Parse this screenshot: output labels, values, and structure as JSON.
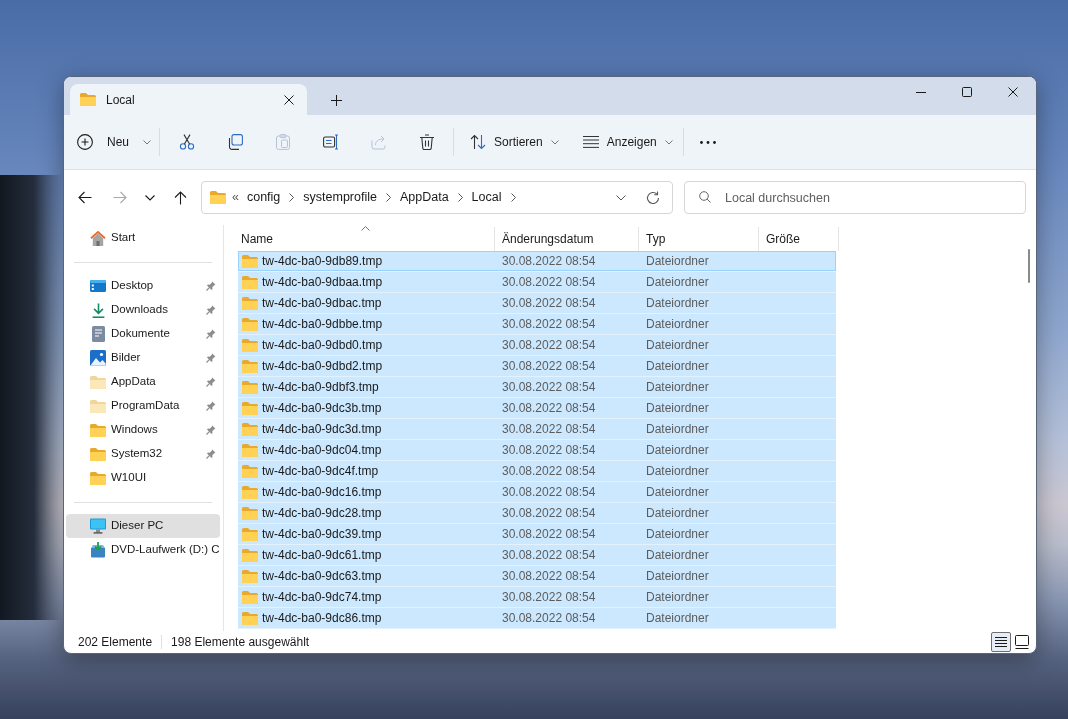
{
  "tabs": [
    {
      "label": "Local",
      "selected": true
    }
  ],
  "toolbar": {
    "new_button": {
      "label": "Neu"
    },
    "actions": [
      {
        "disabled": false
      },
      {
        "disabled": false
      },
      {
        "disabled": true
      },
      {
        "disabled": false
      },
      {
        "disabled": true
      },
      {
        "disabled": false
      }
    ],
    "sort_button": {
      "label": "Sortieren"
    },
    "view_button": {
      "label": "Anzeigen"
    }
  },
  "navigation": {
    "back": {
      "disabled": false
    },
    "forward": {
      "disabled": true
    },
    "up": {
      "disabled": false
    }
  },
  "address_bar": {
    "overflow": "«",
    "path": [
      "config",
      "systemprofile",
      "AppData",
      "Local"
    ]
  },
  "search": {
    "placeholder": "Local durchsuchen"
  },
  "sidebar": {
    "sections": [
      {
        "items": [
          {
            "kind": "home",
            "label": "Start",
            "selected": false
          }
        ]
      },
      {
        "items": [
          {
            "kind": "desktop",
            "label": "Desktop",
            "selected": false,
            "pinned": true,
            "hidden": false
          },
          {
            "kind": "downloads",
            "label": "Downloads",
            "selected": false,
            "pinned": true,
            "hidden": false
          },
          {
            "kind": "documents",
            "label": "Dokumente",
            "selected": false,
            "pinned": true,
            "hidden": false
          },
          {
            "kind": "pictures",
            "label": "Bilder",
            "selected": false,
            "pinned": true,
            "hidden": false
          },
          {
            "kind": "folder",
            "label": "AppData",
            "selected": false,
            "pinned": true,
            "hidden": true
          },
          {
            "kind": "folder",
            "label": "ProgramData",
            "selected": false,
            "pinned": true,
            "hidden": true
          },
          {
            "kind": "folder",
            "label": "Windows",
            "selected": false,
            "pinned": true,
            "hidden": false
          },
          {
            "kind": "folder",
            "label": "System32",
            "selected": false,
            "pinned": true,
            "hidden": false
          },
          {
            "kind": "folder",
            "label": "W10UI",
            "selected": false,
            "pinned": false,
            "hidden": false
          }
        ]
      },
      {
        "items": [
          {
            "kind": "pc",
            "label": "Dieser PC",
            "selected": true
          },
          {
            "kind": "drive",
            "label": "DVD-Laufwerk (D:) C",
            "selected": false
          }
        ]
      }
    ]
  },
  "files": {
    "columns": [
      {
        "label": "Name",
        "sorted": true
      },
      {
        "label": "Änderungsdatum",
        "sorted": false
      },
      {
        "label": "Typ",
        "sorted": false
      },
      {
        "label": "Größe",
        "sorted": false
      }
    ],
    "rows": [
      {
        "name": "tw-4dc-ba0-9db89.tmp",
        "modified": "30.08.2022 08:54",
        "type": "Dateiordner",
        "selected": true,
        "focused": true
      },
      {
        "name": "tw-4dc-ba0-9dbaa.tmp",
        "modified": "30.08.2022 08:54",
        "type": "Dateiordner",
        "selected": true,
        "focused": false
      },
      {
        "name": "tw-4dc-ba0-9dbac.tmp",
        "modified": "30.08.2022 08:54",
        "type": "Dateiordner",
        "selected": true,
        "focused": false
      },
      {
        "name": "tw-4dc-ba0-9dbbe.tmp",
        "modified": "30.08.2022 08:54",
        "type": "Dateiordner",
        "selected": true,
        "focused": false
      },
      {
        "name": "tw-4dc-ba0-9dbd0.tmp",
        "modified": "30.08.2022 08:54",
        "type": "Dateiordner",
        "selected": true,
        "focused": false
      },
      {
        "name": "tw-4dc-ba0-9dbd2.tmp",
        "modified": "30.08.2022 08:54",
        "type": "Dateiordner",
        "selected": true,
        "focused": false
      },
      {
        "name": "tw-4dc-ba0-9dbf3.tmp",
        "modified": "30.08.2022 08:54",
        "type": "Dateiordner",
        "selected": true,
        "focused": false
      },
      {
        "name": "tw-4dc-ba0-9dc3b.tmp",
        "modified": "30.08.2022 08:54",
        "type": "Dateiordner",
        "selected": true,
        "focused": false
      },
      {
        "name": "tw-4dc-ba0-9dc3d.tmp",
        "modified": "30.08.2022 08:54",
        "type": "Dateiordner",
        "selected": true,
        "focused": false
      },
      {
        "name": "tw-4dc-ba0-9dc04.tmp",
        "modified": "30.08.2022 08:54",
        "type": "Dateiordner",
        "selected": true,
        "focused": false
      },
      {
        "name": "tw-4dc-ba0-9dc4f.tmp",
        "modified": "30.08.2022 08:54",
        "type": "Dateiordner",
        "selected": true,
        "focused": false
      },
      {
        "name": "tw-4dc-ba0-9dc16.tmp",
        "modified": "30.08.2022 08:54",
        "type": "Dateiordner",
        "selected": true,
        "focused": false
      },
      {
        "name": "tw-4dc-ba0-9dc28.tmp",
        "modified": "30.08.2022 08:54",
        "type": "Dateiordner",
        "selected": true,
        "focused": false
      },
      {
        "name": "tw-4dc-ba0-9dc39.tmp",
        "modified": "30.08.2022 08:54",
        "type": "Dateiordner",
        "selected": true,
        "focused": false
      },
      {
        "name": "tw-4dc-ba0-9dc61.tmp",
        "modified": "30.08.2022 08:54",
        "type": "Dateiordner",
        "selected": true,
        "focused": false
      },
      {
        "name": "tw-4dc-ba0-9dc63.tmp",
        "modified": "30.08.2022 08:54",
        "type": "Dateiordner",
        "selected": true,
        "focused": false
      },
      {
        "name": "tw-4dc-ba0-9dc74.tmp",
        "modified": "30.08.2022 08:54",
        "type": "Dateiordner",
        "selected": true,
        "focused": false
      },
      {
        "name": "tw-4dc-ba0-9dc86.tmp",
        "modified": "30.08.2022 08:54",
        "type": "Dateiordner",
        "selected": true,
        "focused": false
      }
    ]
  },
  "status_bar": {
    "item_count": "202 Elemente",
    "selection": "198 Elemente ausgewählt",
    "views": [
      {
        "selected": true
      },
      {
        "selected": false
      }
    ]
  }
}
